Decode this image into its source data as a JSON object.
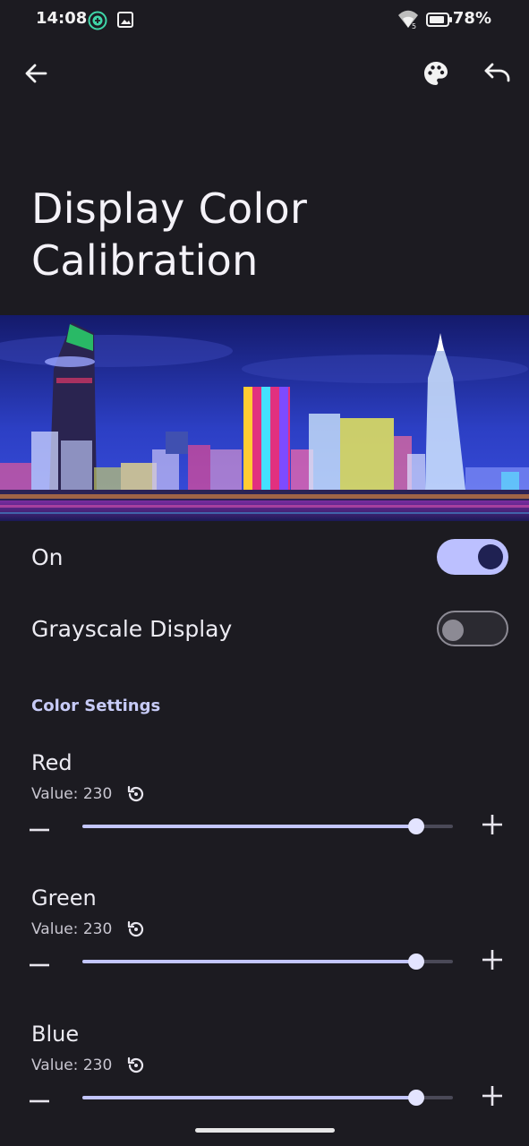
{
  "status_bar": {
    "time": "14:08",
    "battery_percent": "78%",
    "icons": [
      "vpn-icon",
      "image-icon",
      "wifi-icon",
      "battery-icon"
    ]
  },
  "top_bar": {
    "icons": [
      "back-arrow-icon",
      "palette-icon",
      "undo-icon"
    ]
  },
  "page": {
    "title": "Display Color Calibration"
  },
  "banner": {
    "icon": "city-night-skyline-image"
  },
  "toggles": [
    {
      "label": "On",
      "checked": true
    },
    {
      "label": "Grayscale Display",
      "checked": false
    }
  ],
  "color_settings": {
    "header": "Color Settings",
    "channels": [
      {
        "name": "Red",
        "value_text": "Value: 230",
        "value": 230,
        "max": 255
      },
      {
        "name": "Green",
        "value_text": "Value: 230",
        "value": 230,
        "max": 255
      },
      {
        "name": "Blue",
        "value_text": "Value: 230",
        "value": 230,
        "max": 255
      }
    ]
  },
  "colors": {
    "background": "#1c1b21",
    "accent": "#bcc0ff",
    "accent_dark": "#1f2152"
  }
}
